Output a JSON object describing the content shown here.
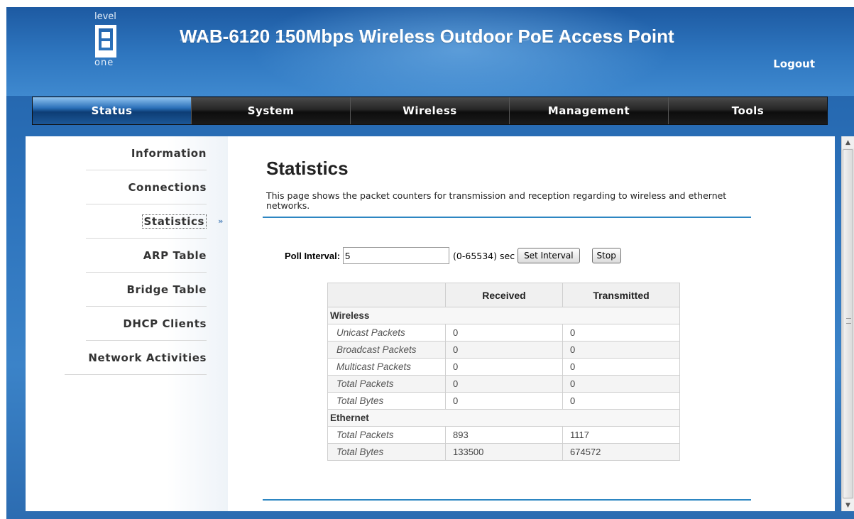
{
  "header": {
    "title": "WAB-6120 150Mbps Wireless Outdoor PoE Access Point",
    "logo_top": "level",
    "logo_bottom": "one",
    "logout_label": "Logout"
  },
  "nav": {
    "items": [
      {
        "label": "Status",
        "active": true
      },
      {
        "label": "System",
        "active": false
      },
      {
        "label": "Wireless",
        "active": false
      },
      {
        "label": "Management",
        "active": false
      },
      {
        "label": "Tools",
        "active": false
      }
    ]
  },
  "sidebar": {
    "items": [
      {
        "label": "Information",
        "active": false
      },
      {
        "label": "Connections",
        "active": false
      },
      {
        "label": "Statistics",
        "active": true
      },
      {
        "label": "ARP Table",
        "active": false
      },
      {
        "label": "Bridge Table",
        "active": false
      },
      {
        "label": "DHCP Clients",
        "active": false
      },
      {
        "label": "Network Activities",
        "active": false
      }
    ],
    "active_arrow": "»"
  },
  "main": {
    "title": "Statistics",
    "description": "This page shows the packet counters for transmission and reception regarding to wireless and ethernet networks.",
    "poll": {
      "label": "Poll Interval:",
      "value": "5",
      "range": "(0-65534) sec",
      "set_button": "Set Interval",
      "stop_button": "Stop"
    },
    "table": {
      "headers": [
        "",
        "Received",
        "Transmitted"
      ],
      "sections": [
        {
          "name": "Wireless",
          "rows": [
            {
              "label": "Unicast Packets",
              "received": "0",
              "transmitted": "0"
            },
            {
              "label": "Broadcast Packets",
              "received": "0",
              "transmitted": "0"
            },
            {
              "label": "Multicast Packets",
              "received": "0",
              "transmitted": "0"
            },
            {
              "label": "Total Packets",
              "received": "0",
              "transmitted": "0"
            },
            {
              "label": "Total Bytes",
              "received": "0",
              "transmitted": "0"
            }
          ]
        },
        {
          "name": "Ethernet",
          "rows": [
            {
              "label": "Total Packets",
              "received": "893",
              "transmitted": "1117"
            },
            {
              "label": "Total Bytes",
              "received": "133500",
              "transmitted": "674572"
            }
          ]
        }
      ]
    }
  },
  "colors": {
    "header_blue": "#2f77c0",
    "accent_rule": "#2d86c2",
    "nav_black": "#1b1b1b"
  }
}
